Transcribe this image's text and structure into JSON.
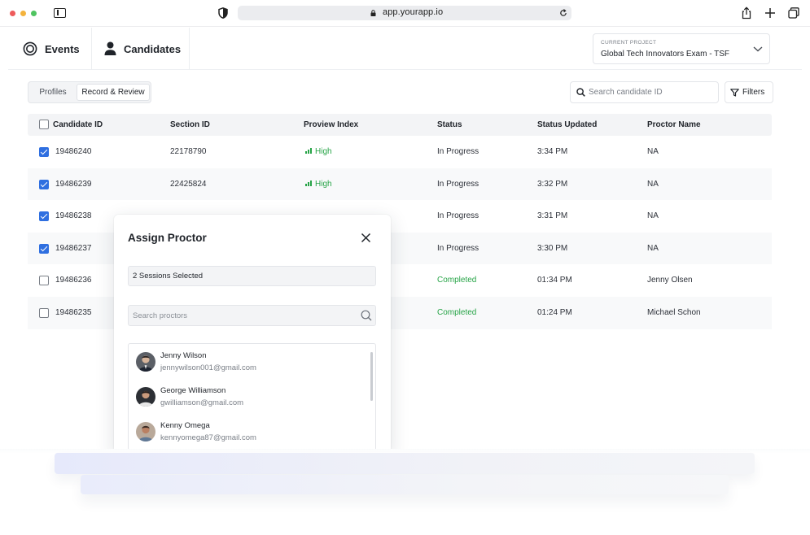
{
  "browser": {
    "url": "app.yourapp.io",
    "traffic_lights": [
      "#ee5b5b",
      "#f4b33d",
      "#4fc460"
    ]
  },
  "header": {
    "tabs": [
      {
        "label": "Events",
        "icon": "target-icon"
      },
      {
        "label": "Candidates",
        "icon": "person-icon"
      }
    ],
    "project": {
      "caption": "CURRENT PROJECT",
      "value": "Global Tech Innovators Exam - TSF"
    }
  },
  "toolbar": {
    "segments": [
      "Profiles",
      "Record & Review"
    ],
    "active_segment": "Record & Review",
    "search_placeholder": "Search candidate ID",
    "filters_label": "Filters"
  },
  "table": {
    "columns": [
      "Candidate ID",
      "Section ID",
      "Proview Index",
      "Status",
      "Status Updated",
      "Proctor Name"
    ],
    "rows": [
      {
        "checked": true,
        "candidate_id": "19486240",
        "section_id": "22178790",
        "proview_index": "High",
        "status": "In Progress",
        "updated": "3:34 PM",
        "proctor": "NA"
      },
      {
        "checked": true,
        "candidate_id": "19486239",
        "section_id": "22425824",
        "proview_index": "High",
        "status": "In Progress",
        "updated": "3:32 PM",
        "proctor": "NA"
      },
      {
        "checked": true,
        "candidate_id": "19486238",
        "section_id": "",
        "proview_index": "",
        "status": "In Progress",
        "updated": "3:31 PM",
        "proctor": "NA"
      },
      {
        "checked": true,
        "candidate_id": "19486237",
        "section_id": "",
        "proview_index": "",
        "status": "In Progress",
        "updated": "3:30 PM",
        "proctor": "NA"
      },
      {
        "checked": false,
        "candidate_id": "19486236",
        "section_id": "",
        "proview_index": "",
        "status": "Completed",
        "updated": "01:34 PM",
        "proctor": "Jenny Olsen"
      },
      {
        "checked": false,
        "candidate_id": "19486235",
        "section_id": "",
        "proview_index": "",
        "status": "Completed",
        "updated": "01:24 PM",
        "proctor": "Michael Schon"
      }
    ],
    "status_colors": {
      "In Progress": "#2c3038",
      "Completed": "#27a447"
    },
    "index_color": "#27a447"
  },
  "modal": {
    "title": "Assign Proctor",
    "selected_text": "2 Sessions Selected",
    "search_placeholder": "Search proctors",
    "proctors": [
      {
        "name": "Jenny Wilson",
        "email": "jennywilson001@gmail.com",
        "avatar": "avatar-icon"
      },
      {
        "name": "George Williamson",
        "email": "gwilliamson@gmail.com",
        "avatar": "avatar-icon"
      },
      {
        "name": "Kenny Omega",
        "email": "kennyomega87@gmail.com",
        "avatar": "avatar-icon"
      }
    ]
  }
}
